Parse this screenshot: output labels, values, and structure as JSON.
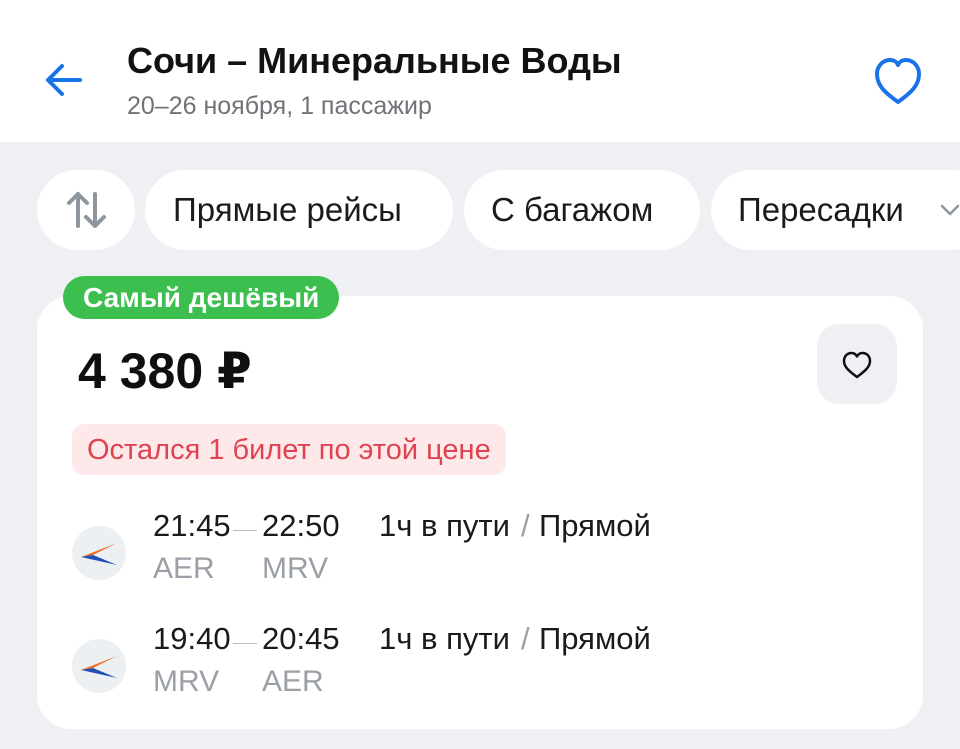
{
  "header": {
    "title": "Сочи – Минеральные Воды",
    "subtitle": "20–26 ноября, 1 пассажир",
    "back_icon": "arrow-left-icon",
    "favorite_icon": "heart-outline-icon",
    "accent_color": "#1a73e8"
  },
  "filters": {
    "sort_icon": "sort-arrows-icon",
    "chips": [
      {
        "label": "Прямые рейсы"
      },
      {
        "label": "С багажом"
      },
      {
        "label": "Пересадки",
        "icon": "chevron-down-icon"
      }
    ]
  },
  "offer": {
    "badge": "Самый дешёвый",
    "badge_color": "#3cbf4f",
    "price": "4 380 ₽",
    "warning": "Остался 1 билет по этой цене",
    "warning_color": "#e0434f",
    "favorite_icon": "heart-outline-icon",
    "segments": [
      {
        "airline_icon": "airline-logo-icon",
        "depart_time": "21:45",
        "arrive_time": "22:50",
        "depart_code": "AER",
        "arrive_code": "MRV",
        "duration": "1ч в пути",
        "separator": "/",
        "type": "Прямой"
      },
      {
        "airline_icon": "airline-logo-icon",
        "depart_time": "19:40",
        "arrive_time": "20:45",
        "depart_code": "MRV",
        "arrive_code": "AER",
        "duration": "1ч в пути",
        "separator": "/",
        "type": "Прямой"
      }
    ]
  }
}
